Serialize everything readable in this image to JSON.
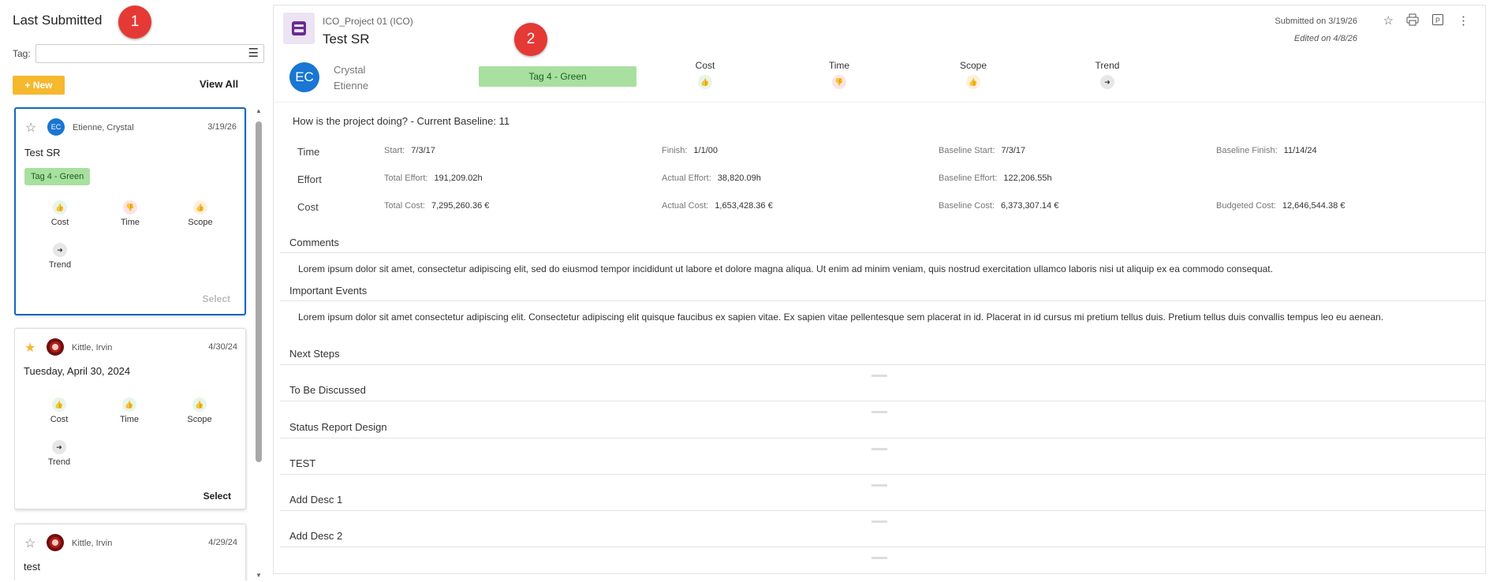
{
  "left_panel": {
    "title": "Last Submitted",
    "marker": "1",
    "tag_label": "Tag:",
    "tag_value": "",
    "new_button": "+ New",
    "view_all": "View All"
  },
  "cards": [
    {
      "starred": false,
      "initials": "EC",
      "names": "Etienne, Crystal",
      "date": "3/19/26",
      "title": "Test SR",
      "tag": "Tag 4 - Green",
      "indicators": [
        {
          "label": "Cost",
          "icon": "thumbs-up-icon",
          "color": "green"
        },
        {
          "label": "Time",
          "icon": "thumbs-down-icon",
          "color": "red"
        },
        {
          "label": "Scope",
          "icon": "mixed-thumbs-icon",
          "color": "orange"
        },
        {
          "label": "Trend",
          "icon": "arrow-right-icon",
          "color": "gray"
        }
      ],
      "select": "Select"
    },
    {
      "starred": true,
      "names": "Kittle, Irvin",
      "date": "4/30/24",
      "title": "Tuesday, April 30, 2024",
      "indicators": [
        {
          "label": "Cost",
          "icon": "thumbs-up-icon",
          "color": "green"
        },
        {
          "label": "Time",
          "icon": "thumbs-up-icon",
          "color": "green"
        },
        {
          "label": "Scope",
          "icon": "thumbs-up-icon",
          "color": "green"
        },
        {
          "label": "Trend",
          "icon": "arrow-right-icon",
          "color": "gray"
        }
      ],
      "select": "Select"
    },
    {
      "starred": false,
      "names": "Kittle, Irvin",
      "date": "4/29/24",
      "title": "test"
    }
  ],
  "detail": {
    "marker": "2",
    "project": "ICO_Project 01 (ICO)",
    "title": "Test SR",
    "submitted": "Submitted on 3/19/26",
    "edited": "Edited on 4/8/26",
    "initials": "EC",
    "first_name": "Crystal",
    "last_name": "Etienne",
    "tag": "Tag 4 - Green",
    "indicators": [
      {
        "label": "Cost",
        "icon": "thumbs-up-icon",
        "color": "green"
      },
      {
        "label": "Time",
        "icon": "thumbs-down-icon",
        "color": "red"
      },
      {
        "label": "Scope",
        "icon": "mixed-thumbs-icon",
        "color": "orange"
      },
      {
        "label": "Trend",
        "icon": "arrow-right-icon",
        "color": "gray"
      }
    ],
    "question": "How is the project doing? - Current Baseline:  11",
    "metrics": [
      {
        "label": "Time",
        "cells": [
          {
            "k": "Start:",
            "v": "7/3/17"
          },
          {
            "k": "Finish:",
            "v": "1/1/00"
          },
          {
            "k": "Baseline Start:",
            "v": "7/3/17"
          },
          {
            "k": "Baseline Finish:",
            "v": "11/14/24"
          }
        ]
      },
      {
        "label": "Effort",
        "cells": [
          {
            "k": "Total Effort:",
            "v": "191,209.02h"
          },
          {
            "k": "Actual Effort:",
            "v": "38,820.09h"
          },
          {
            "k": "Baseline Effort:",
            "v": "122,206.55h"
          },
          {
            "k": "",
            "v": ""
          }
        ]
      },
      {
        "label": "Cost",
        "cells": [
          {
            "k": "Total Cost:",
            "v": "7,295,260.36 €"
          },
          {
            "k": "Actual Cost:",
            "v": "1,653,428.36 €"
          },
          {
            "k": "Baseline Cost:",
            "v": "6,373,307.14 €"
          },
          {
            "k": "Budgeted Cost:",
            "v": "12,646,544.38 €"
          }
        ]
      }
    ],
    "sections": {
      "comments": "Comments",
      "comments_text": "Lorem ipsum dolor sit amet, consectetur adipiscing elit, sed do eiusmod tempor incididunt ut labore et dolore magna aliqua. Ut enim ad minim veniam, quis nostrud exercitation ullamco laboris nisi ut aliquip ex ea commodo consequat.",
      "important_events": "Important Events",
      "important_events_text": "Lorem ipsum dolor sit amet consectetur adipiscing elit. Consectetur adipiscing elit quisque faucibus ex sapien vitae. Ex sapien vitae pellentesque sem placerat in id. Placerat in id cursus mi pretium tellus duis. Pretium tellus duis convallis tempus leo eu aenean.",
      "next_steps": "Next Steps",
      "to_be_discussed": "To Be Discussed",
      "status_report_design": "Status Report Design",
      "test": "TEST",
      "add_desc_1": "Add Desc 1",
      "add_desc_2": "Add Desc 2"
    }
  }
}
